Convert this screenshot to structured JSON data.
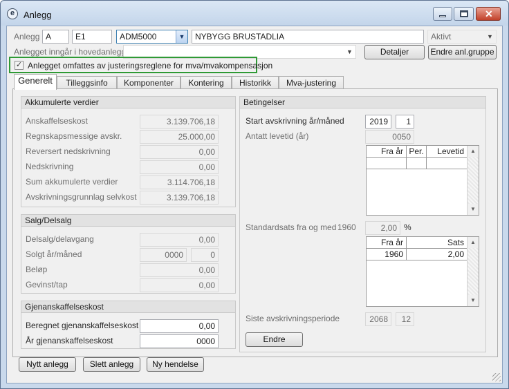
{
  "window": {
    "title": "Anlegg"
  },
  "header": {
    "anlegg_label": "Anlegg",
    "anlegg_field1": "A",
    "anlegg_field2": "E1",
    "anlegg_code": "ADM5000",
    "anlegg_name": "NYBYGG BRUSTADLIA",
    "status": "Aktivt",
    "hovedanlegg_label": "Anlegget inngår i hovedanlegg",
    "hovedanlegg_value": "",
    "detaljer_button": "Detaljer",
    "endre_gruppe_button": "Endre anl.gruppe",
    "checkbox_label": "Anlegget omfattes av justeringsreglene for mva/mvakompensasjon",
    "checkbox_checked": true
  },
  "tabs": [
    {
      "label": "Generelt",
      "active": true
    },
    {
      "label": "Tilleggsinfo",
      "active": false
    },
    {
      "label": "Komponenter",
      "active": false
    },
    {
      "label": "Kontering",
      "active": false
    },
    {
      "label": "Historikk",
      "active": false
    },
    {
      "label": "Mva-justering",
      "active": false
    }
  ],
  "akkumulerte": {
    "title": "Akkumulerte verdier",
    "rows": [
      {
        "label": "Anskaffelseskost",
        "value": "3.139.706,18"
      },
      {
        "label": "Regnskapsmessige avskr.",
        "value": "25.000,00"
      },
      {
        "label": "Reversert nedskrivning",
        "value": "0,00"
      },
      {
        "label": "Nedskrivning",
        "value": "0,00"
      },
      {
        "label": "Sum akkumulerte verdier",
        "value": "3.114.706,18"
      },
      {
        "label": "Avskrivningsgrunnlag selvkost",
        "value": "3.139.706,18"
      }
    ]
  },
  "salg": {
    "title": "Salg/Delsalg",
    "delsalg_label": "Delsalg/delavgang",
    "delsalg_value": "0,00",
    "solgt_label": "Solgt år/måned",
    "solgt_year": "0000",
    "solgt_month": "0",
    "belop_label": "Beløp",
    "belop_value": "0,00",
    "gevinst_label": "Gevinst/tap",
    "gevinst_value": "0,00"
  },
  "gjenanskaffelse": {
    "title": "Gjenanskaffelseskost",
    "beregnet_label": "Beregnet gjenanskaffelseskost",
    "beregnet_value": "0,00",
    "aar_label": "År gjenanskaffelseskost",
    "aar_value": "0000"
  },
  "betingelser": {
    "title": "Betingelser",
    "start_label": "Start avskrivning år/måned",
    "start_year": "2019",
    "start_month": "1",
    "levetid_label": "Antatt levetid (år)",
    "levetid_value": "0050",
    "levetid_grid": {
      "headers": [
        "Fra år",
        "Per.",
        "Levetid"
      ],
      "rows": []
    },
    "standardsats_label": "Standardsats fra og med",
    "standardsats_year": "1960",
    "standardsats_value": "2,00",
    "standardsats_unit": "%",
    "sats_grid": {
      "headers": [
        "Fra år",
        "Sats"
      ],
      "rows": [
        [
          "1960",
          "2,00"
        ]
      ]
    },
    "siste_label": "Siste avskrivningsperiode",
    "siste_year": "2068",
    "siste_month": "12",
    "endre_button": "Endre"
  },
  "footer": {
    "nytt_button": "Nytt anlegg",
    "slett_button": "Slett anlegg",
    "ny_hendelse_button": "Ny hendelse"
  }
}
